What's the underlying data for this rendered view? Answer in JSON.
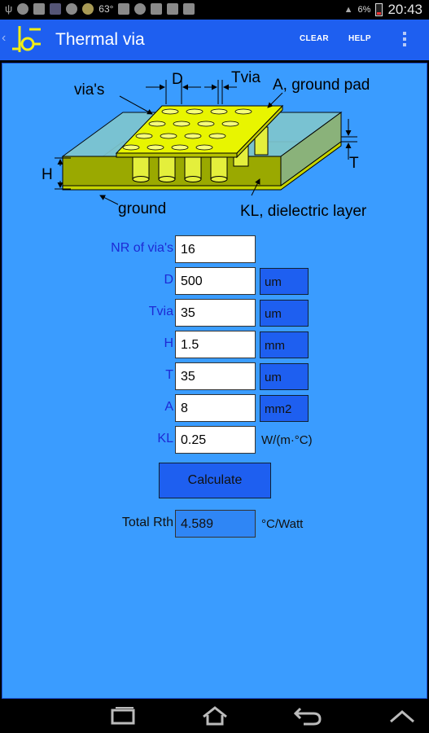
{
  "status_bar": {
    "temperature": "63°",
    "battery": "6%",
    "time": "20:43"
  },
  "app_bar": {
    "title": "Thermal via",
    "clear_label": "CLEAR",
    "help_label": "HELP"
  },
  "diagram": {
    "labels": {
      "vias": "via's",
      "d": "D",
      "tvia": "Tvia",
      "pad": "A, ground pad",
      "h": "H",
      "t": "T",
      "ground": "ground",
      "kl": "KL, dielectric layer"
    }
  },
  "form": {
    "nr_vias": {
      "label": "NR of via's",
      "value": "16"
    },
    "d": {
      "label": "D",
      "value": "500",
      "unit": "um"
    },
    "tvia": {
      "label": "Tvia",
      "value": "35",
      "unit": "um"
    },
    "h": {
      "label": "H",
      "value": "1.5",
      "unit": "mm"
    },
    "t": {
      "label": "T",
      "value": "35",
      "unit": "um"
    },
    "a": {
      "label": "A",
      "value": "8",
      "unit": "mm2"
    },
    "kl": {
      "label": "KL",
      "value": "0.25",
      "unit": "W/(m·°C)"
    }
  },
  "calculate_label": "Calculate",
  "result": {
    "label": "Total Rth",
    "value": "4.589",
    "unit": "°C/Watt"
  },
  "colors": {
    "action_bar": "#1e5ff0",
    "content_bg": "#3a9cff",
    "label_blue": "#1e2ad4",
    "pad_yellow": "#e8f500"
  }
}
